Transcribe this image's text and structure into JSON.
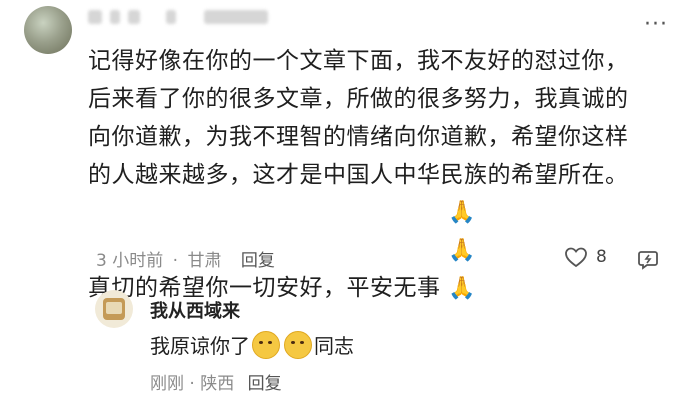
{
  "comment": {
    "lines": [
      "记得好像在你的一个文章下面，我不友好的怼过你，",
      "后来看了你的很多文章，所做的很多努力，我真诚的",
      "向你道歉，为我不理智的情绪向你道歉，希望你这样",
      "的人越来越多，这才是中国人中华民族的希望所在。",
      "真切的希望你一切安好，平安无事"
    ],
    "emoji": "🙏🙏🙏",
    "time": "3 小时前",
    "dot": "·",
    "location": "甘肃",
    "reply_label": "回复",
    "like_count": "8"
  },
  "reply": {
    "username": "我从西域来",
    "text_before": "我原谅你了",
    "text_after": "同志",
    "time": "刚刚",
    "dot": "·",
    "location": "陕西",
    "reply_label": "回复"
  },
  "icons": {
    "more": "more-dots-icon",
    "like": "heart-outline-icon",
    "share": "share-icon"
  }
}
